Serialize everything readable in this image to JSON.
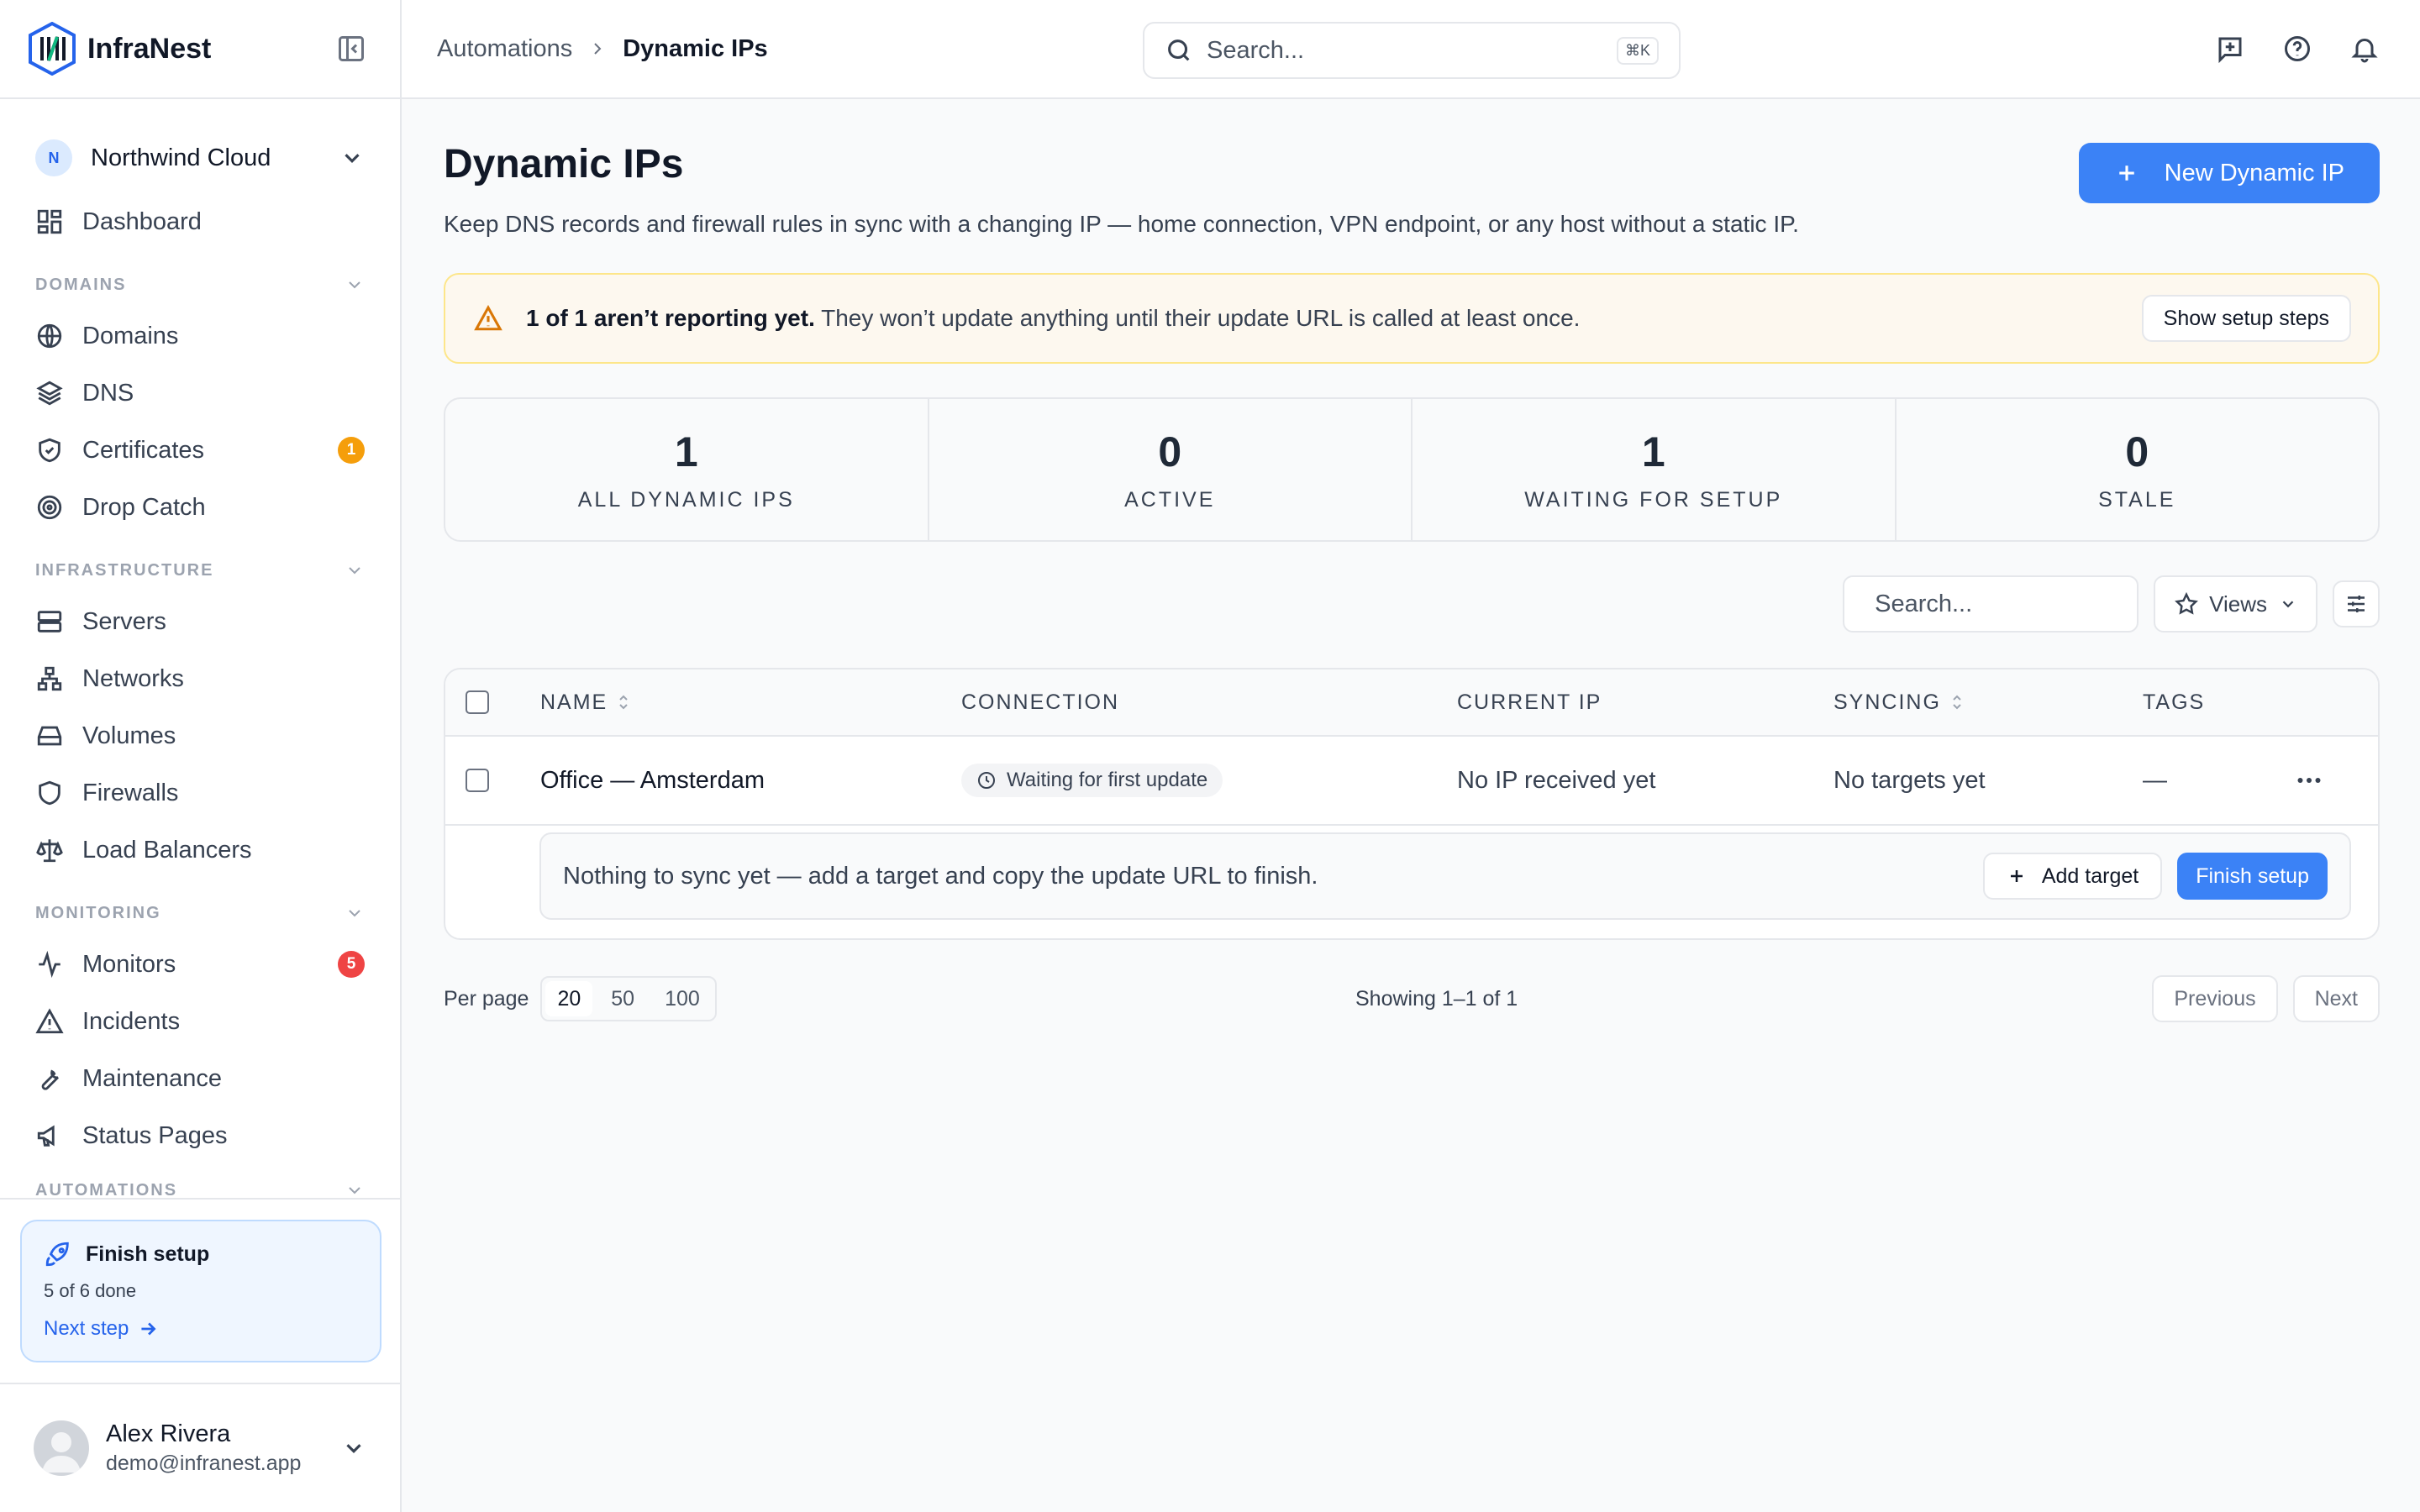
{
  "app": {
    "name": "InfraNest"
  },
  "org": {
    "initial": "N",
    "name": "Northwind Cloud"
  },
  "nav": {
    "dashboard": "Dashboard",
    "domains_section": "DOMAINS",
    "domains": "Domains",
    "dns": "DNS",
    "certificates": "Certificates",
    "certificates_badge": "1",
    "drop_catch": "Drop Catch",
    "infra_section": "INFRASTRUCTURE",
    "servers": "Servers",
    "networks": "Networks",
    "volumes": "Volumes",
    "firewalls": "Firewalls",
    "load_balancers": "Load Balancers",
    "monitoring_section": "MONITORING",
    "monitors": "Monitors",
    "monitors_badge": "5",
    "incidents": "Incidents",
    "maintenance": "Maintenance",
    "status_pages": "Status Pages",
    "automations_section": "AUTOMATIONS"
  },
  "setup_card": {
    "title": "Finish setup",
    "progress": "5 of 6 done",
    "next": "Next step"
  },
  "user": {
    "name": "Alex Rivera",
    "email": "demo@infranest.app"
  },
  "breadcrumb": {
    "parent": "Automations",
    "current": "Dynamic IPs"
  },
  "global_search": {
    "placeholder": "Search...",
    "shortcut": "⌘K"
  },
  "page": {
    "title": "Dynamic IPs",
    "description": "Keep DNS records and firewall rules in sync with a changing IP — home connection, VPN endpoint, or any host without a static IP.",
    "new_button": "New Dynamic IP"
  },
  "alert": {
    "bold": "1 of 1 aren’t reporting yet.",
    "text": " They won’t update anything until their update URL is called at least once.",
    "button": "Show setup steps"
  },
  "stats": [
    {
      "value": "1",
      "label": "ALL DYNAMIC IPS"
    },
    {
      "value": "0",
      "label": "ACTIVE"
    },
    {
      "value": "1",
      "label": "WAITING FOR SETUP"
    },
    {
      "value": "0",
      "label": "STALE"
    }
  ],
  "table_toolbar": {
    "search_placeholder": "Search...",
    "views": "Views"
  },
  "table": {
    "columns": {
      "name": "NAME",
      "connection": "CONNECTION",
      "current_ip": "CURRENT IP",
      "syncing": "SYNCING",
      "tags": "TAGS"
    },
    "rows": [
      {
        "name": "Office — Amsterdam",
        "connection": "Waiting for first update",
        "current_ip": "No IP received yet",
        "syncing": "No targets yet",
        "tags": "—"
      }
    ],
    "subrow": {
      "message": "Nothing to sync yet — add a target and copy the update URL to finish.",
      "add_target": "Add target",
      "finish": "Finish setup"
    }
  },
  "footer": {
    "per_page_label": "Per page",
    "per_page_options": [
      "20",
      "50",
      "100"
    ],
    "selected": "20",
    "showing": "Showing 1–1 of 1",
    "previous": "Previous",
    "next": "Next"
  },
  "colors": {
    "primary": "#3b82f6",
    "warning": "#d97706",
    "badge_orange": "#f59e0b",
    "badge_red": "#ef4444"
  }
}
